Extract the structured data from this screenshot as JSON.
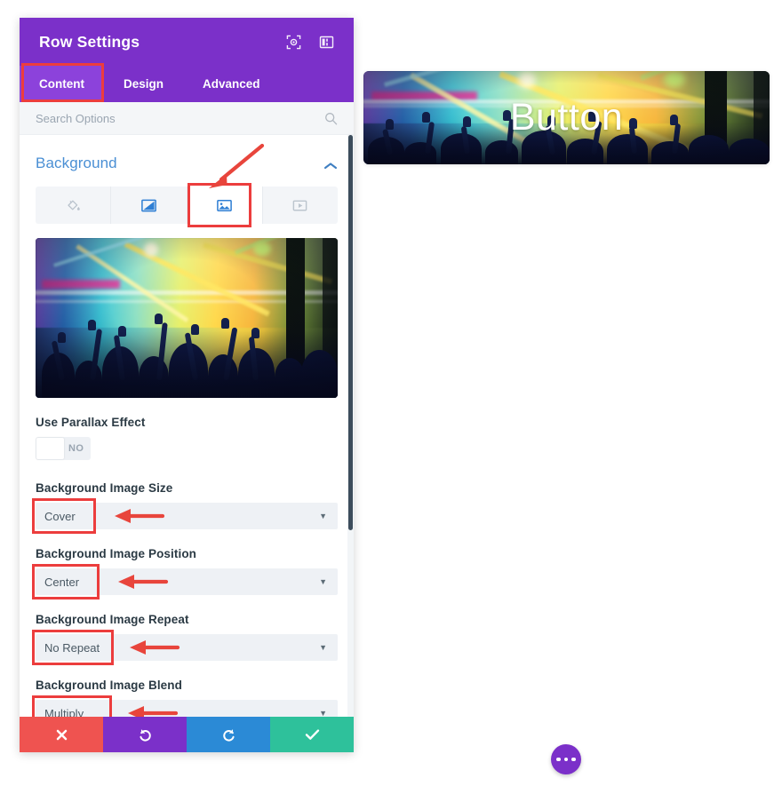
{
  "panel": {
    "title": "Row Settings",
    "titlebar_icons": [
      {
        "name": "focus-target-icon"
      },
      {
        "name": "layout-columns-icon"
      }
    ],
    "tabs": [
      {
        "label": "Content",
        "active": true,
        "highlighted": true
      },
      {
        "label": "Design",
        "active": false,
        "highlighted": false
      },
      {
        "label": "Advanced",
        "active": false,
        "highlighted": false
      }
    ],
    "search": {
      "placeholder": "Search Options",
      "value": ""
    },
    "section": {
      "title": "Background",
      "collapse_icon": "chevron-up-icon"
    },
    "background_types": [
      {
        "name": "background-color-tab",
        "icon": "paint-bucket-icon",
        "selected": false
      },
      {
        "name": "background-gradient-tab",
        "icon": "gradient-icon",
        "selected": false
      },
      {
        "name": "background-image-tab",
        "icon": "image-icon",
        "selected": true,
        "highlighted": true
      },
      {
        "name": "background-video-tab",
        "icon": "video-icon",
        "selected": false
      }
    ],
    "image_preview": {
      "alt": "concert crowd background image"
    },
    "fields": [
      {
        "label": "Use Parallax Effect",
        "type": "toggle",
        "value": "NO",
        "on": false
      },
      {
        "label": "Background Image Size",
        "type": "select",
        "value": "Cover",
        "highlighted": true,
        "arrow": true
      },
      {
        "label": "Background Image Position",
        "type": "select",
        "value": "Center",
        "highlighted": true,
        "arrow": true
      },
      {
        "label": "Background Image Repeat",
        "type": "select",
        "value": "No Repeat",
        "highlighted": true,
        "arrow": true
      },
      {
        "label": "Background Image Blend",
        "type": "select",
        "value": "Multiply",
        "highlighted": true,
        "arrow": true
      }
    ],
    "footer_buttons": [
      {
        "name": "cancel-button",
        "icon": "close-x-icon",
        "color": "#ef5350"
      },
      {
        "name": "undo-button",
        "icon": "undo-arrow-icon",
        "color": "#7b30c9"
      },
      {
        "name": "redo-button",
        "icon": "redo-arrow-icon",
        "color": "#2b8ad6"
      },
      {
        "name": "save-button",
        "icon": "checkmark-icon",
        "color": "#2ec19b"
      }
    ]
  },
  "preview": {
    "button_label": "Button"
  },
  "fab": {
    "icon": "ellipsis-icon"
  },
  "colors": {
    "purple": "#7b30c9",
    "purple_light": "#8c42db",
    "annotation_red": "#ec3d3d",
    "section_blue": "#4a8fd4",
    "save_green": "#2ec19b",
    "redo_blue": "#2b8ad6",
    "cancel_red": "#ef5350"
  }
}
